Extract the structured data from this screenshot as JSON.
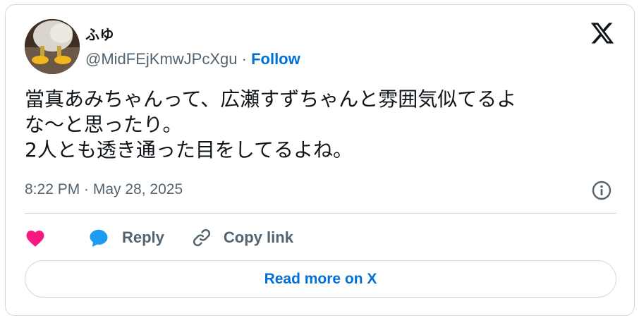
{
  "author": {
    "display_name": "ふゆ",
    "handle": "@MidFEjKmwJPcXgu",
    "separator": "·",
    "follow_label": "Follow"
  },
  "tweet": {
    "text": "當真あみちゃんって、広瀬すずちゃんと雰囲気似てるよ\nな〜と思ったり。\n2人とも透き通った目をしてるよね。",
    "timestamp": "8:22 PM · May 28, 2025"
  },
  "actions": {
    "reply_label": "Reply",
    "copy_link_label": "Copy link"
  },
  "read_more_label": "Read more on X",
  "icons": {
    "logo": "x-logo-icon",
    "info": "info-icon",
    "heart": "heart-icon",
    "reply": "speech-bubble-icon",
    "copy_link": "link-icon"
  },
  "colors": {
    "link_blue": "#006fd6",
    "heart_pink": "#f91880",
    "reply_blue": "#1d9bf0",
    "text_primary": "#0f1419",
    "text_secondary": "#536471",
    "border": "#cfd9de"
  }
}
